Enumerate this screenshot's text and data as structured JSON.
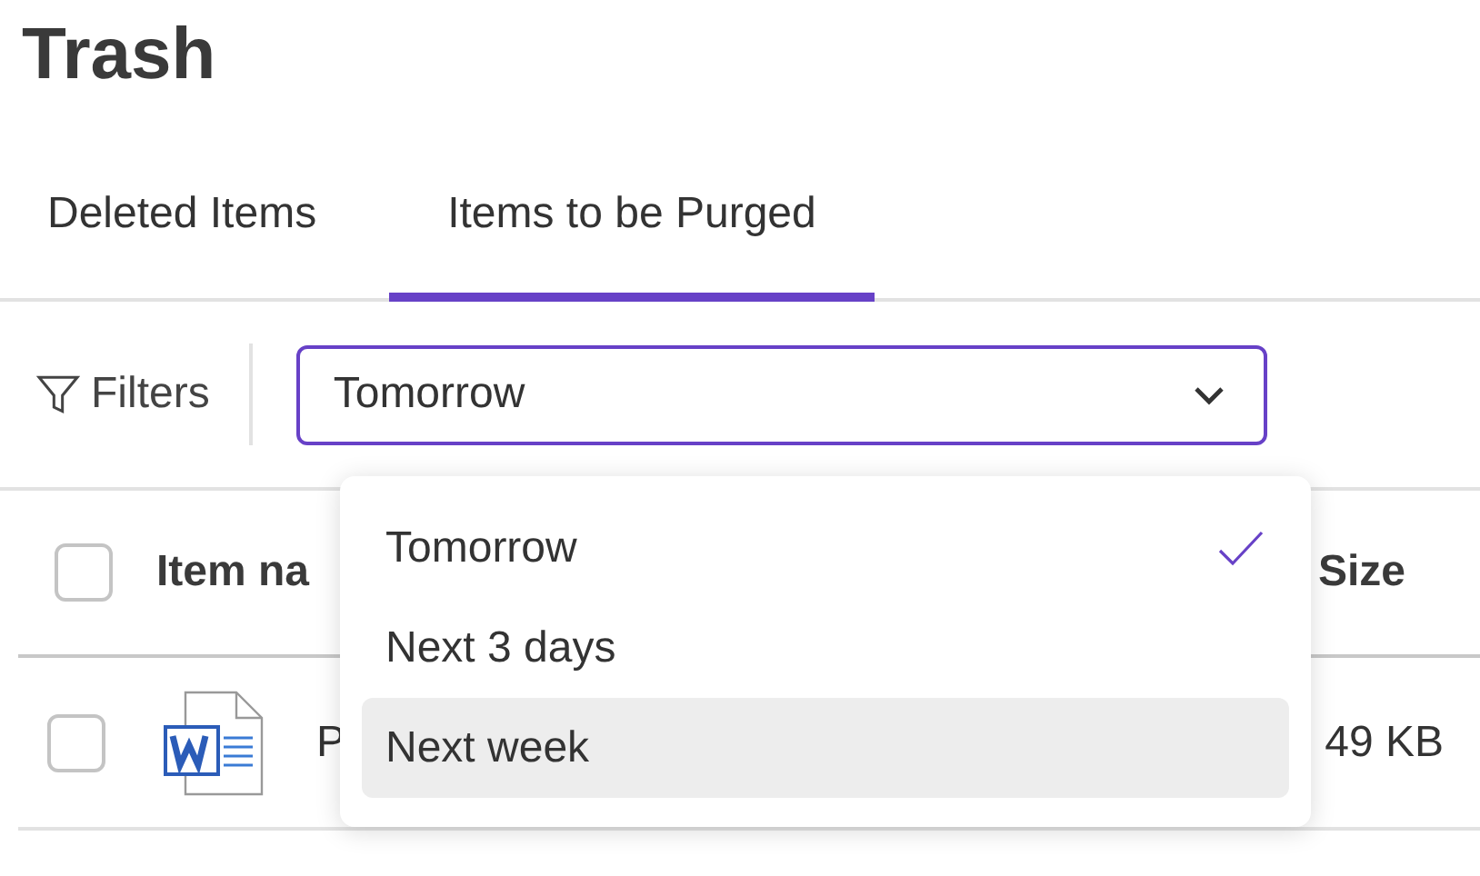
{
  "page": {
    "title": "Trash"
  },
  "tabs": [
    {
      "label": "Deleted Items",
      "selected": false
    },
    {
      "label": "Items to be Purged",
      "selected": true
    }
  ],
  "toolbar": {
    "filters_label": "Filters",
    "select": {
      "value": "Tomorrow",
      "expanded": true
    }
  },
  "dropdown": {
    "options": [
      {
        "label": "Tomorrow",
        "selected": true,
        "highlighted": false
      },
      {
        "label": "Next 3 days",
        "selected": false,
        "highlighted": false
      },
      {
        "label": "Next week",
        "selected": false,
        "highlighted": true
      }
    ]
  },
  "table": {
    "header": {
      "checked": false,
      "name": "Item na",
      "size": "Size"
    },
    "rows": [
      {
        "checked": false,
        "name": "P",
        "size": "49 KB"
      }
    ]
  }
}
